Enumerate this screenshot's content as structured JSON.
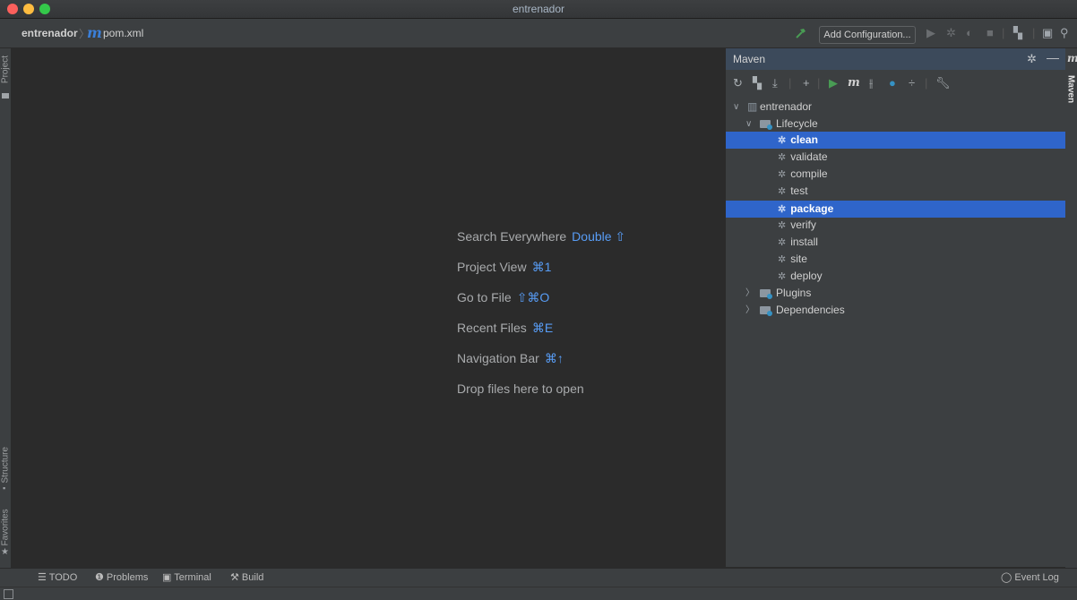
{
  "window": {
    "title": "entrenador"
  },
  "navbar": {
    "project": "entrenador",
    "file_icon": "m",
    "file": "pom.xml",
    "add_configuration": "Add Configuration..."
  },
  "left_strip": {
    "project": "Project",
    "structure": "Structure",
    "favorites": "Favorites"
  },
  "editor": {
    "hints": [
      {
        "label": "Search Everywhere",
        "key": "Double ⇧"
      },
      {
        "label": "Project View",
        "key": "⌘1"
      },
      {
        "label": "Go to File",
        "key": "⇧⌘O"
      },
      {
        "label": "Recent Files",
        "key": "⌘E"
      },
      {
        "label": "Navigation Bar",
        "key": "⌘↑"
      }
    ],
    "drop": "Drop files here to open"
  },
  "maven": {
    "title": "Maven",
    "tab_label": "Maven",
    "project": "entrenador",
    "lifecycle": "Lifecycle",
    "goals": [
      "clean",
      "validate",
      "compile",
      "test",
      "package",
      "verify",
      "install",
      "site",
      "deploy"
    ],
    "selected": [
      "clean",
      "package"
    ],
    "plugins": "Plugins",
    "dependencies": "Dependencies"
  },
  "bottom": {
    "todo": "TODO",
    "problems": "Problems",
    "terminal": "Terminal",
    "build": "Build",
    "event_log": "Event Log"
  },
  "colors": {
    "selection": "#2f65ca",
    "accent": "#589df6",
    "run_green": "#499c54"
  }
}
